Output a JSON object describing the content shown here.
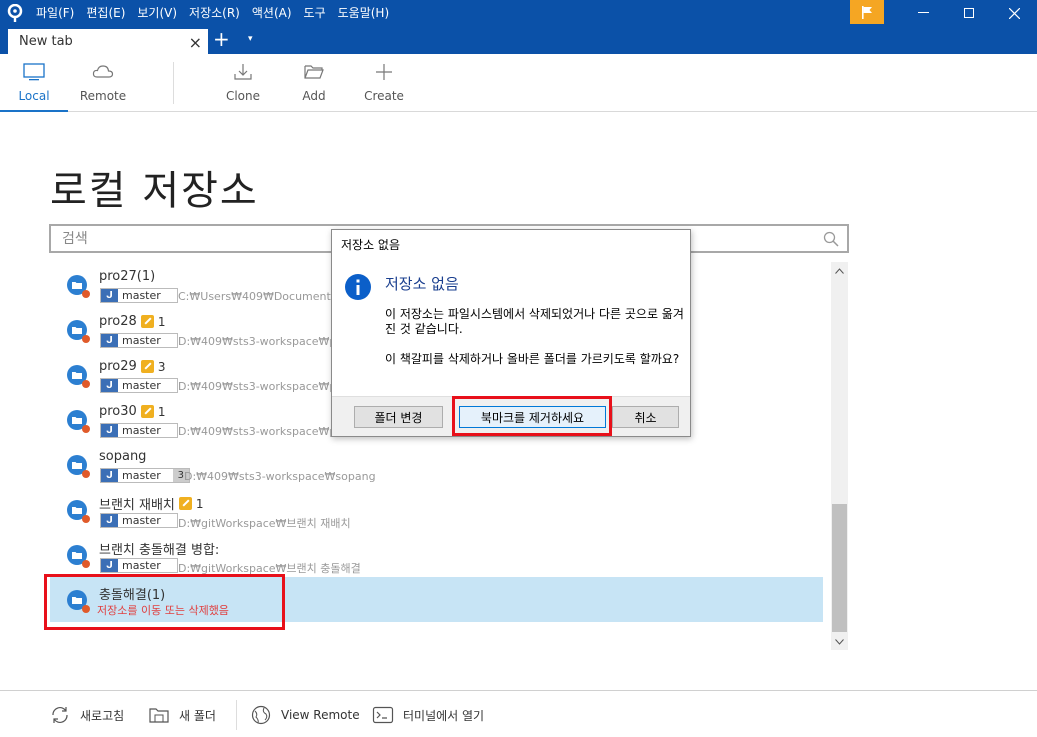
{
  "menu": [
    "파일(F)",
    "편집(E)",
    "보기(V)",
    "저장소(R)",
    "액션(A)",
    "도구",
    "도움말(H)"
  ],
  "tab": {
    "label": "New tab",
    "close": "×",
    "add": "+",
    "more": "▾"
  },
  "toolbar": {
    "local": "Local",
    "remote": "Remote",
    "clone": "Clone",
    "add": "Add",
    "create": "Create"
  },
  "page_title": "로컬 저장소",
  "search": {
    "placeholder": "검색"
  },
  "repos": [
    {
      "name": "pro27(1)",
      "branch": "master",
      "path": "C:₩Users₩409₩Documents₩pro"
    },
    {
      "name": "pro28",
      "changes": "1",
      "branch": "master",
      "path": "D:₩409₩sts3-workspace₩pro2"
    },
    {
      "name": "pro29",
      "changes": "3",
      "branch": "master",
      "path": "D:₩409₩sts3-workspace₩pro2"
    },
    {
      "name": "pro30",
      "changes": "1",
      "branch": "master",
      "path": "D:₩409₩sts3-workspace₩pro3"
    },
    {
      "name": "sopang",
      "branch": "master",
      "ahead": "3",
      "path": "D:₩409₩sts3-workspace₩sopang"
    },
    {
      "name": "브랜치 재배치",
      "changes": "1",
      "branch": "master",
      "path": "D:₩gitWorkspace₩브랜치 재배치"
    },
    {
      "name": "브랜치 충돌해결 병합:",
      "branch": "master",
      "path": "D:₩gitWorkspace₩브랜치 충돌해결"
    },
    {
      "name": "충돌해결(1)",
      "error": "저장소를 이동 또는 삭제했음"
    }
  ],
  "dialog": {
    "title": "저장소 없음",
    "heading": "저장소 없음",
    "message1": "이 저장소는 파일시스템에서 삭제되었거나 다른 곳으로 옮겨진 것 같습니다.",
    "message2": "이 책갈피를 삭제하거나 올바른 폴더를 가르키도록 할까요?",
    "btn_change": "폴더 변경",
    "btn_remove": "북마크를 제거하세요",
    "btn_cancel": "취소"
  },
  "bottom": {
    "refresh": "새로고침",
    "new_folder": "새 폴더",
    "view_remote": "View Remote",
    "terminal": "터미널에서 열기"
  },
  "colors": {
    "titlebar": "#0b51a8",
    "accent": "#1a73c8",
    "highlight": "#e8101a",
    "selected_row": "#c7e4f5"
  }
}
